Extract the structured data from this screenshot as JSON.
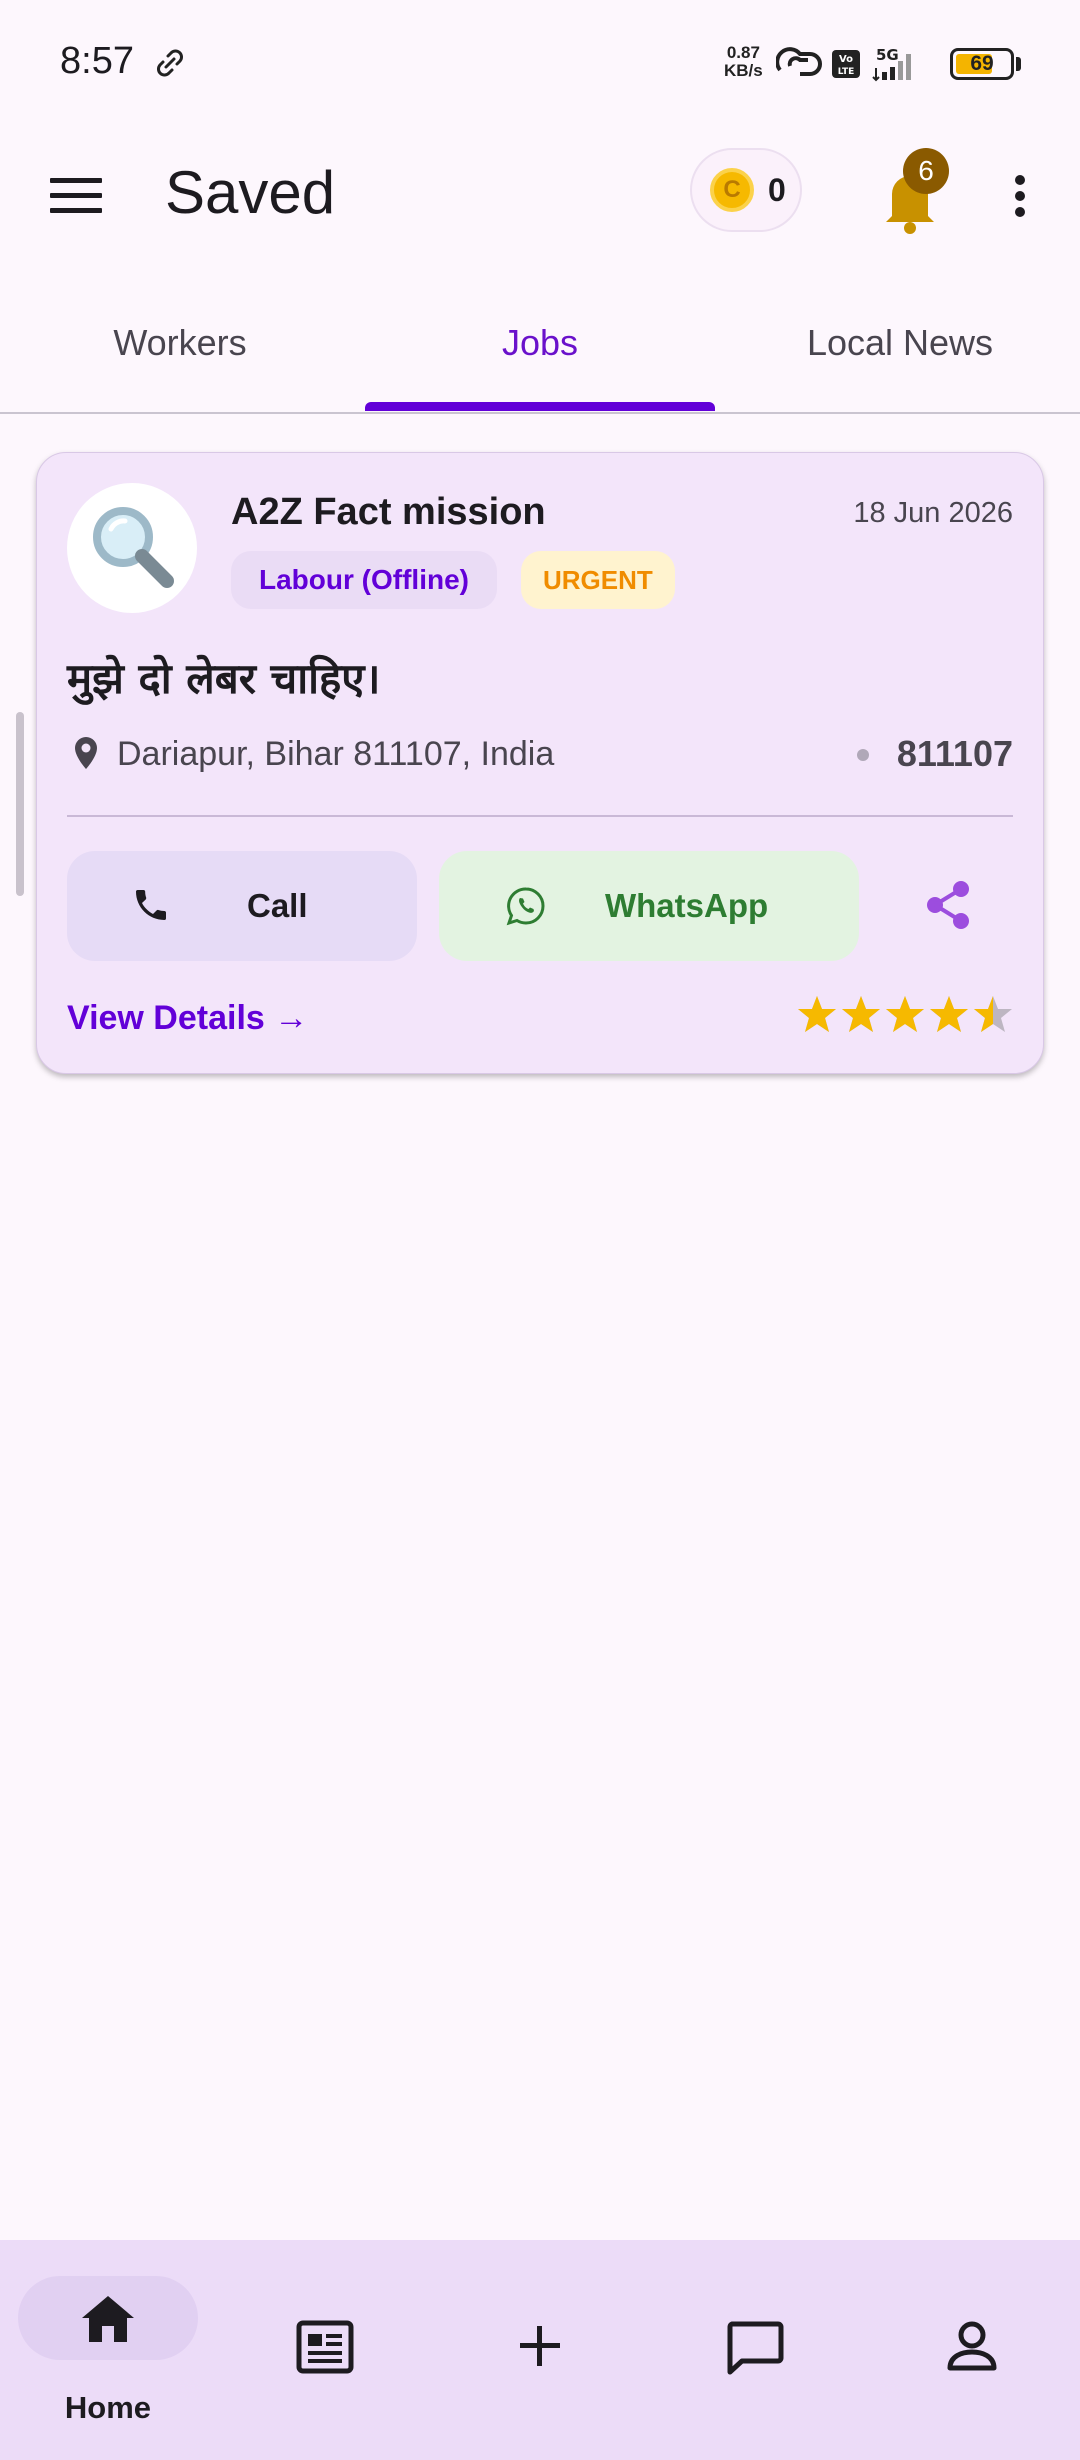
{
  "status_bar": {
    "time": "8:57",
    "net_speed_value": "0.87",
    "net_speed_unit": "KB/s",
    "network": "5G",
    "battery_level": "69"
  },
  "app_bar": {
    "title": "Saved",
    "coin_symbol": "C",
    "coin_count": "0",
    "notification_count": "6"
  },
  "tabs": [
    {
      "label": "Workers",
      "active": false
    },
    {
      "label": "Jobs",
      "active": true
    },
    {
      "label": "Local News",
      "active": false
    }
  ],
  "job_card": {
    "avatar_icon": "magnifying-glass-icon",
    "company": "A2Z Fact mission",
    "date": "18 Jun 2026",
    "category": "Labour (Offline)",
    "urgency": "URGENT",
    "title": "मुझे दो लेबर चाहिए।",
    "location": "Dariapur, Bihar 811107, India",
    "pincode": "811107",
    "call_label": "Call",
    "whatsapp_label": "WhatsApp",
    "view_details_label": "View Details →",
    "rating": 4.5
  },
  "bottom_nav": {
    "home_label": "Home"
  },
  "colors": {
    "accent": "#6200d8",
    "card_bg": "#f3e5fa",
    "whatsapp_green": "#2e7d32",
    "star": "#f6b900",
    "urgent": "#f08c00"
  }
}
